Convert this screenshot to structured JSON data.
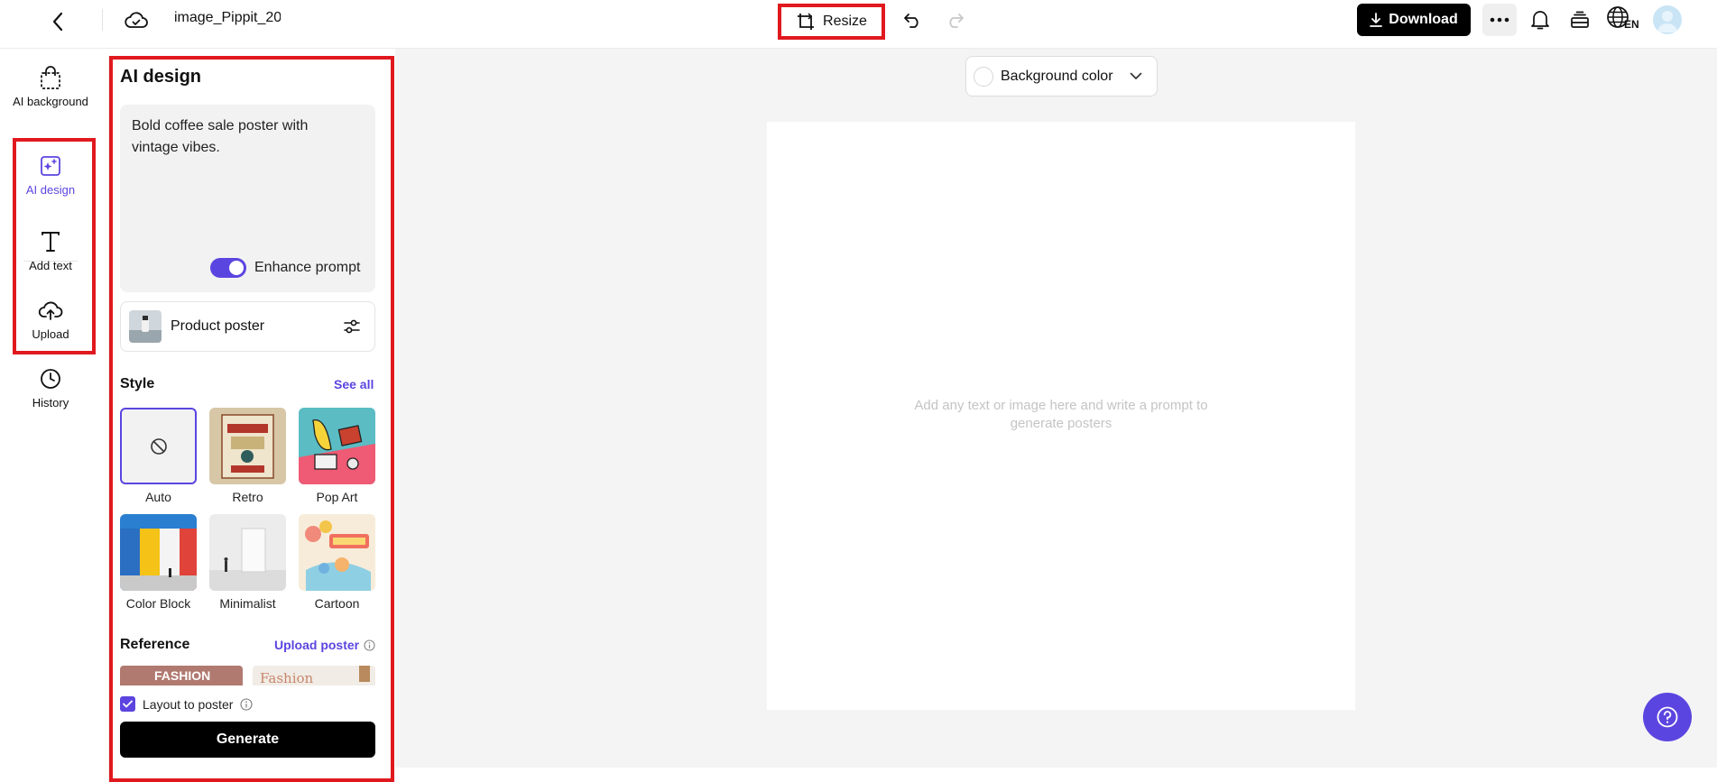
{
  "header": {
    "filename": "image_Pippit_20",
    "resize_label": "Resize",
    "download_label": "Download",
    "language_code": "EN"
  },
  "rail": {
    "items": [
      {
        "label": "AI background",
        "icon": "bag-icon"
      },
      {
        "label": "AI design",
        "icon": "ai-design-icon",
        "active": true
      },
      {
        "label": "Add text",
        "icon": "text-icon"
      },
      {
        "label": "Upload",
        "icon": "upload-cloud-icon"
      },
      {
        "label": "History",
        "icon": "clock-icon"
      }
    ]
  },
  "panel": {
    "title": "AI design",
    "prompt_text": "Bold coffee sale poster with vintage vibes.",
    "enhance_label": "Enhance prompt",
    "enhance_enabled": true,
    "poster_type_label": "Product poster",
    "style_title": "Style",
    "see_all_label": "See all",
    "styles": [
      {
        "label": "Auto",
        "selected": true
      },
      {
        "label": "Retro"
      },
      {
        "label": "Pop Art"
      },
      {
        "label": "Color Block"
      },
      {
        "label": "Minimalist"
      },
      {
        "label": "Cartoon"
      }
    ],
    "reference_title": "Reference",
    "upload_poster_label": "Upload poster",
    "reference_thumbs": [
      "FASHION",
      "Fashion"
    ],
    "layout_label": "Layout to poster",
    "layout_checked": true,
    "generate_label": "Generate"
  },
  "canvas": {
    "bg_color_label": "Background color",
    "hint": "Add any text or image here and write a prompt to generate posters"
  },
  "colors": {
    "accent": "#5b45e0",
    "highlight": "#e0191f"
  }
}
